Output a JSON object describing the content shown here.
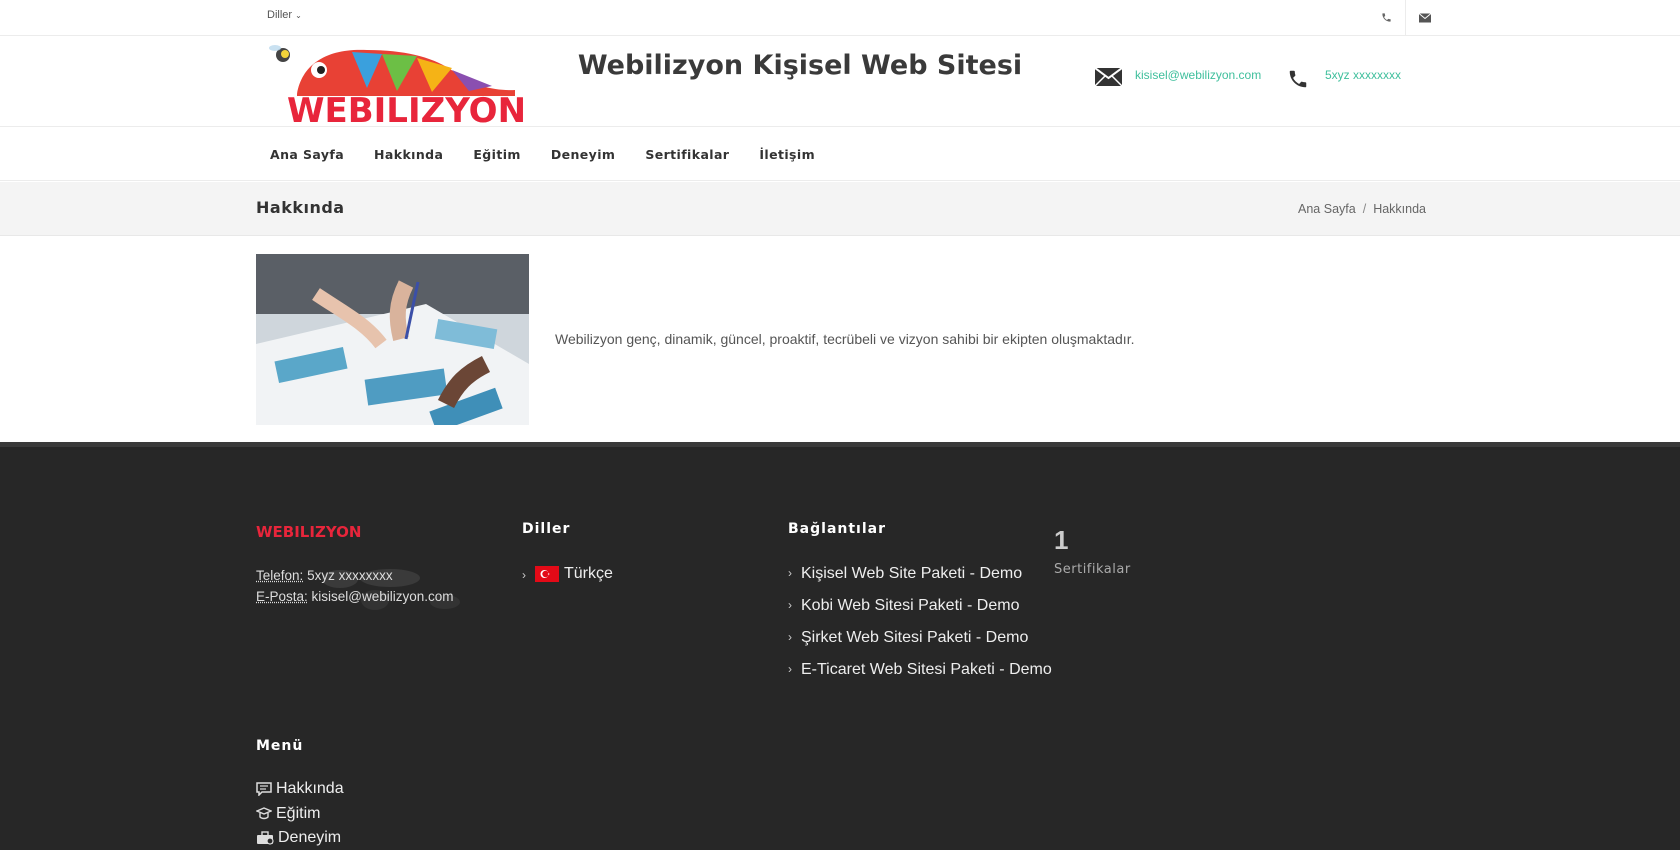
{
  "topbar": {
    "lang_label": "Diller"
  },
  "header": {
    "title": "Webilizyon Kişisel Web Sitesi",
    "email": "kisisel@webilizyon.com",
    "phone": "5xyz xxxxxxxx",
    "logo_text": "WEBILIZYON"
  },
  "nav": {
    "items": [
      "Ana Sayfa",
      "Hakkında",
      "Eğitim",
      "Deneyim",
      "Sertifikalar",
      "İletişim"
    ]
  },
  "title_bar": {
    "title": "Hakkında",
    "breadcrumb": [
      "Ana Sayfa",
      "Hakkında"
    ],
    "separator": "/"
  },
  "content": {
    "text": "Webilizyon genç, dinamik, güncel, proaktif, tecrübeli ve vizyon sahibi bir ekipten oluşmaktadır."
  },
  "footer": {
    "logo_text": "WEBILIZYON",
    "tel_label": "Telefon:",
    "tel_value": "5xyz xxxxxxxx",
    "mail_label": "E-Posta:",
    "mail_value": "kisisel@webilizyon.com",
    "langs_heading": "Diller",
    "lang_item": "Türkçe",
    "links_heading": "Bağlantılar",
    "links": [
      "Kişisel Web Site Paketi - Demo",
      "Kobi Web Sitesi Paketi - Demo",
      "Şirket Web Sitesi Paketi - Demo",
      "E-Ticaret Web Sitesi Paketi - Demo"
    ],
    "counter_value": "1",
    "counter_label": "Sertifikalar",
    "menu_heading": "Menü",
    "menu": [
      "Hakkında",
      "Eğitim",
      "Deneyim"
    ]
  },
  "colors": {
    "accent": "#3fbf9c",
    "footer_bg": "#272727",
    "titlebar_bg": "#f4f4f4"
  }
}
